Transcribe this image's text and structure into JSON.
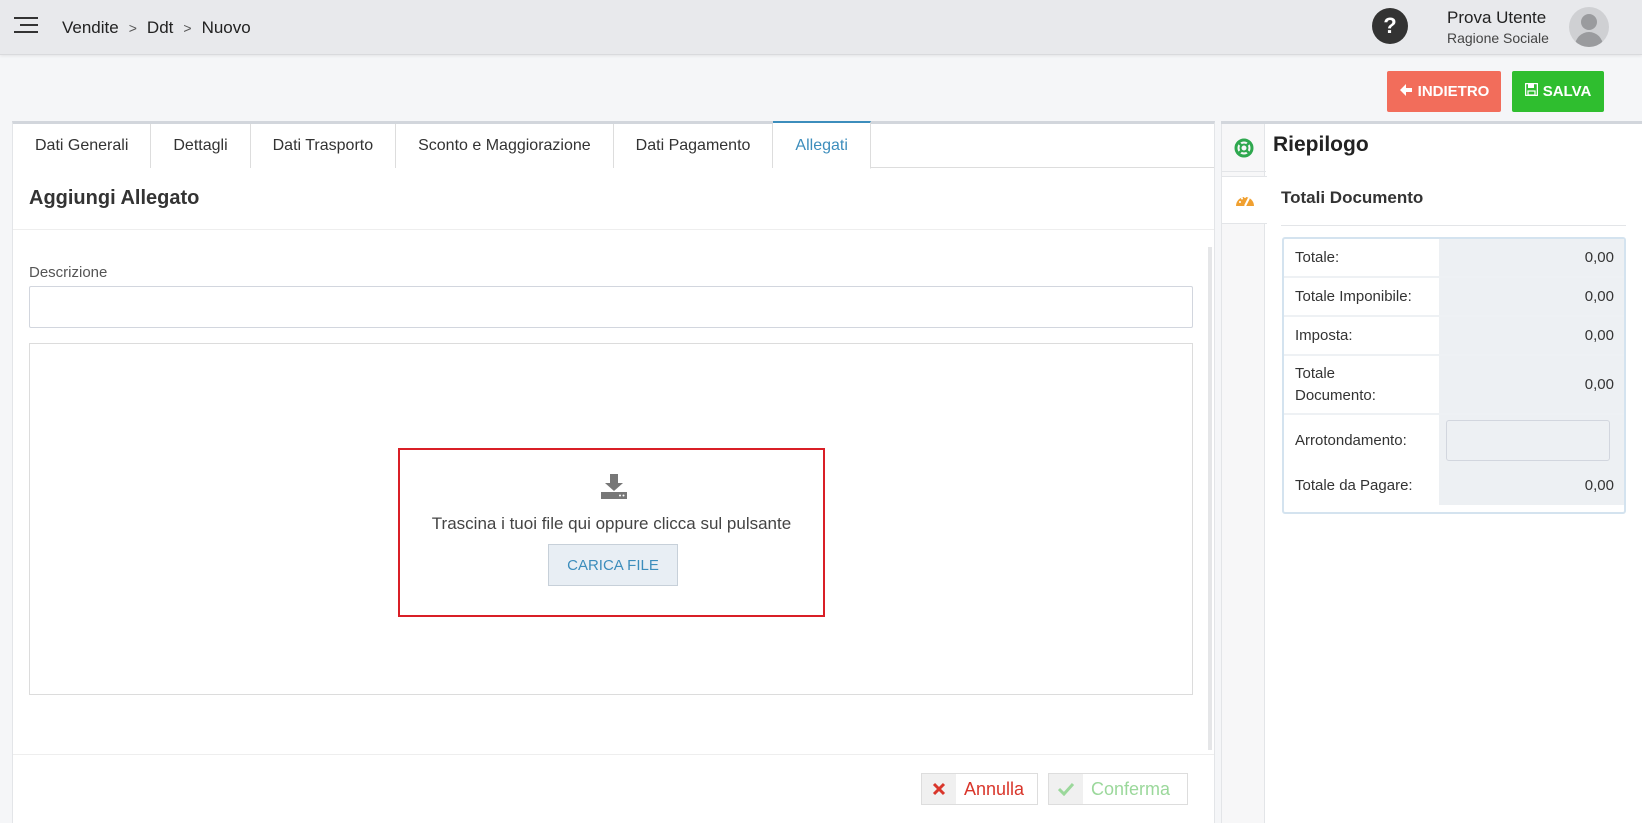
{
  "header": {
    "breadcrumb": [
      "Vendite",
      "Ddt",
      "Nuovo"
    ],
    "user_name": "Prova Utente",
    "user_company": "Ragione Sociale",
    "help_icon": "question-icon",
    "menu_icon": "hamburger-icon"
  },
  "toolbar": {
    "back_label": "INDIETRO",
    "save_label": "SALVA",
    "back_color": "#f26d5b",
    "save_color": "#2fbe2f"
  },
  "tabs": [
    {
      "label": "Dati Generali",
      "active": false
    },
    {
      "label": "Dettagli",
      "active": false
    },
    {
      "label": "Dati Trasporto",
      "active": false
    },
    {
      "label": "Sconto e Maggiorazione",
      "active": false
    },
    {
      "label": "Dati Pagamento",
      "active": false
    },
    {
      "label": "Allegati",
      "active": true
    }
  ],
  "form": {
    "title": "Aggiungi Allegato",
    "description_label": "Descrizione",
    "description_value": "",
    "dropzone_text": "Trascina i tuoi file qui oppure clicca sul pulsante",
    "upload_button": "CARICA FILE",
    "cancel_label": "Annulla",
    "confirm_label": "Conferma"
  },
  "sidebar": {
    "title": "Riepilogo",
    "totals_title": "Totali Documento",
    "rows": [
      {
        "label": "Totale:",
        "value": "0,00"
      },
      {
        "label": "Totale Imponibile:",
        "value": "0,00"
      },
      {
        "label": "Imposta:",
        "value": "0,00"
      },
      {
        "label": "Totale Documento:",
        "value": "0,00"
      },
      {
        "label": "Arrotondamento:",
        "value": ""
      },
      {
        "label": "Totale da Pagare:",
        "value": "0,00"
      }
    ]
  },
  "colors": {
    "accent": "#3c8dbc",
    "highlight_border": "#d91f26",
    "cancel_text": "#d9362b",
    "confirm_text": "#9bd89b"
  }
}
